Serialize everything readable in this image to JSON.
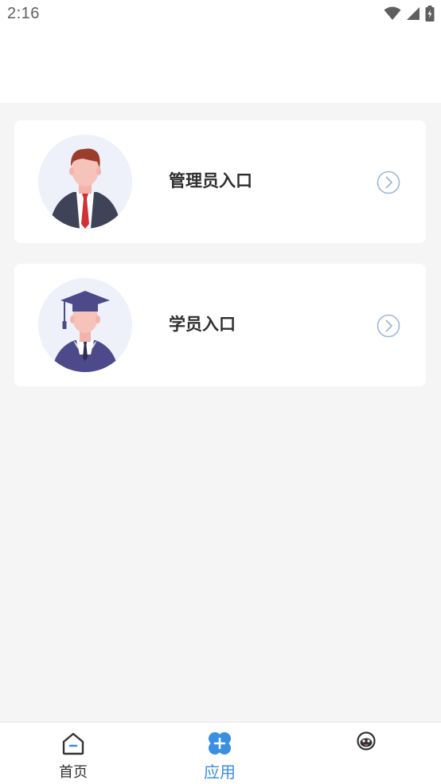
{
  "status_bar": {
    "time": "2:16"
  },
  "entries": [
    {
      "label": "管理员入口",
      "icon": "admin-avatar"
    },
    {
      "label": "学员入口",
      "icon": "student-avatar"
    }
  ],
  "tabbar": {
    "active": "应用",
    "accent_color": "#3a8fe0",
    "tabs": [
      {
        "label": "首页",
        "icon": "home-icon"
      },
      {
        "label": "应用",
        "icon": "apps-icon"
      },
      {
        "label": "",
        "icon": "profile-face-icon"
      }
    ]
  }
}
